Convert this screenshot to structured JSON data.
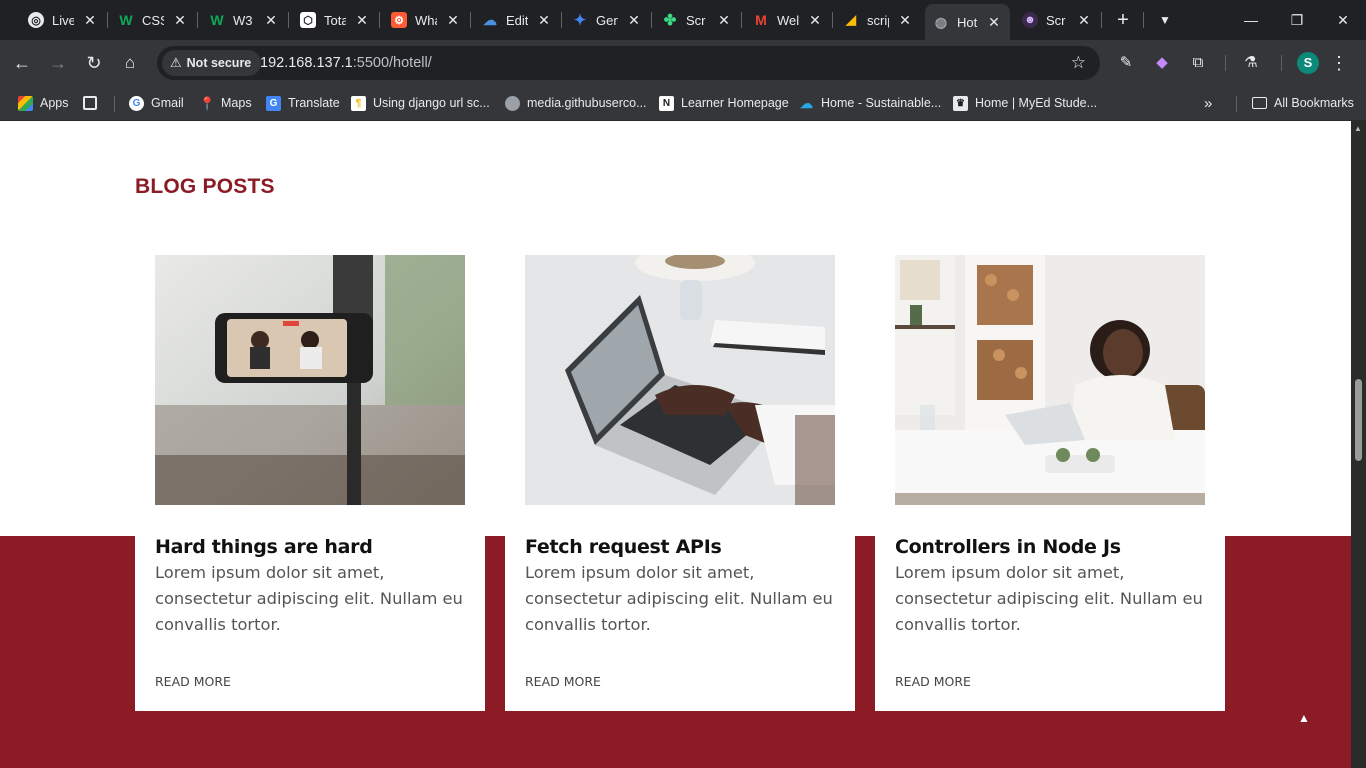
{
  "tabs": [
    {
      "title": "Live",
      "icon": "gauge-icon",
      "color": "#5f6368"
    },
    {
      "title": "CSS",
      "icon": "w-icon",
      "color": "#0b8a4a"
    },
    {
      "title": "W3",
      "icon": "w-icon",
      "color": "#0b8a4a"
    },
    {
      "title": "Tota",
      "icon": "cube-icon",
      "color": "#ffffff"
    },
    {
      "title": "Wha",
      "icon": "hubspot-icon",
      "color": "#ff5c35"
    },
    {
      "title": "Edit",
      "icon": "cloud-icon",
      "color": "#1a73e8"
    },
    {
      "title": "Gen",
      "icon": "sparkle-icon",
      "color": "#4285f4"
    },
    {
      "title": "Scr",
      "icon": "clover-icon",
      "color": "#3ddc84"
    },
    {
      "title": "Wel",
      "icon": "gmail-icon",
      "color": "#ea4335"
    },
    {
      "title": "scrip",
      "icon": "chart-icon",
      "color": "#fbbc04"
    },
    {
      "title": "Hot",
      "icon": "globe-icon",
      "color": "#9aa0a6",
      "active": true
    },
    {
      "title": "Scr",
      "icon": "robot-icon",
      "color": "#8e44ad"
    }
  ],
  "address": {
    "security_label": "Not secure",
    "host": "192.168.137.1",
    "path": ":5500/hotell/"
  },
  "bookmarks": [
    {
      "label": "Apps",
      "icon": "apps-icon",
      "color": "#ea4335"
    },
    {
      "label": "Gmail",
      "icon": "google-icon",
      "color": "#4285f4"
    },
    {
      "label": "Maps",
      "icon": "maps-icon",
      "color": "#34a853"
    },
    {
      "label": "Translate",
      "icon": "translate-icon",
      "color": "#4285f4"
    },
    {
      "label": "Using django url sc...",
      "icon": "doc-icon",
      "color": "#f4b400"
    },
    {
      "label": "media.githubuserco...",
      "icon": "globe-icon",
      "color": "#9aa0a6"
    },
    {
      "label": "Learner Homepage",
      "icon": "n-icon",
      "color": "#202124"
    },
    {
      "label": "Home - Sustainable...",
      "icon": "onedrive-icon",
      "color": "#28a8ea"
    },
    {
      "label": "Home | MyEd Stude...",
      "icon": "crest-icon",
      "color": "#5f6368"
    }
  ],
  "all_bookmarks_label": "All Bookmarks",
  "page": {
    "section_title": "BLOG POSTS",
    "posts": [
      {
        "title": "Hard things are hard",
        "excerpt": "Lorem ipsum dolor sit amet, consectetur adipiscing elit. Nullam eu convallis tortor.",
        "read_more": "READ MORE"
      },
      {
        "title": "Fetch request APIs",
        "excerpt": "Lorem ipsum dolor sit amet, consectetur adipiscing elit. Nullam eu convallis tortor.",
        "read_more": "READ MORE"
      },
      {
        "title": "Controllers in Node Js",
        "excerpt": "Lorem ipsum dolor sit amet, consectetur adipiscing elit. Nullam eu convallis tortor.",
        "read_more": "READ MORE"
      }
    ]
  },
  "colors": {
    "brand": "#8b1c26",
    "browser_dark": "#202124",
    "toolbar": "#35363a"
  }
}
